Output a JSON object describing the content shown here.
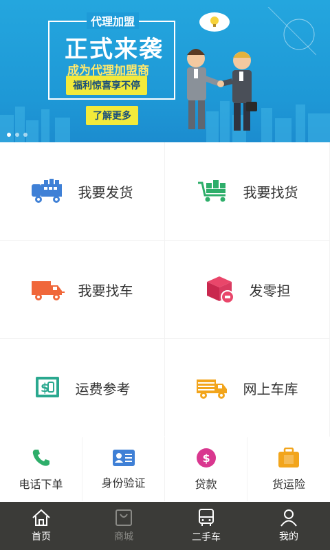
{
  "banner": {
    "tag": "代理加盟",
    "headline": "正式来袭",
    "subhead": "成为代理加盟商",
    "pill": "福利惊喜享不停",
    "more_button": "了解更多"
  },
  "services": [
    {
      "label": "我要发货",
      "icon": "delivery-truck-icon"
    },
    {
      "label": "我要找货",
      "icon": "cart-icon"
    },
    {
      "label": "我要找车",
      "icon": "truck-icon"
    },
    {
      "label": "发零担",
      "icon": "box-sell-icon"
    },
    {
      "label": "运费参考",
      "icon": "price-ledger-icon"
    },
    {
      "label": "网上车库",
      "icon": "garage-truck-icon"
    }
  ],
  "quick": [
    {
      "label": "电话下单",
      "icon": "phone-icon"
    },
    {
      "label": "身份验证",
      "icon": "id-card-icon"
    },
    {
      "label": "贷款",
      "icon": "dollar-icon"
    },
    {
      "label": "货运险",
      "icon": "insurance-bag-icon"
    }
  ],
  "tabs": [
    {
      "label": "首页",
      "icon": "home-icon"
    },
    {
      "label": "商城",
      "icon": "shop-bag-icon"
    },
    {
      "label": "二手车",
      "icon": "bus-icon"
    },
    {
      "label": "我的",
      "icon": "user-icon"
    }
  ],
  "colors": {
    "banner_bg": "#1e98d6",
    "accent_yellow": "#f2ea3a",
    "tabbar_bg": "#3b3b38"
  }
}
